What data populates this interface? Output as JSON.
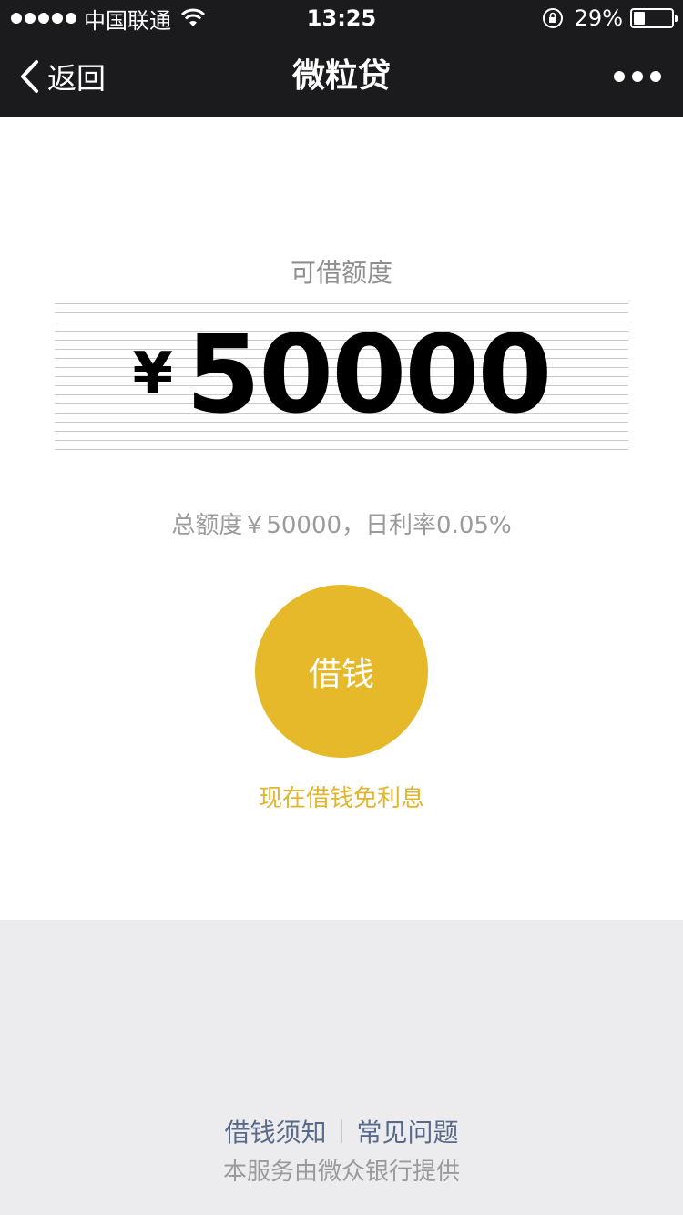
{
  "status_bar": {
    "carrier": "中国联通",
    "time": "13:25",
    "battery_percent_text": "29%",
    "battery_level": 0.29
  },
  "nav": {
    "back_label": "返回",
    "title": "微粒贷"
  },
  "main": {
    "quota_label": "可借额度",
    "currency_symbol": "¥",
    "available_amount": "50000",
    "summary": "总额度￥50000，日利率0.05%",
    "borrow_button_label": "借钱",
    "promo_text": "现在借钱免利息"
  },
  "footer": {
    "link_notice": "借钱须知",
    "link_faq": "常见问题",
    "provider_text": "本服务由微众银行提供"
  },
  "colors": {
    "bar_background": "#1b1b1e",
    "accent_gold": "#e5b92a",
    "footer_background": "#ececee",
    "link_color": "#586a8a"
  }
}
